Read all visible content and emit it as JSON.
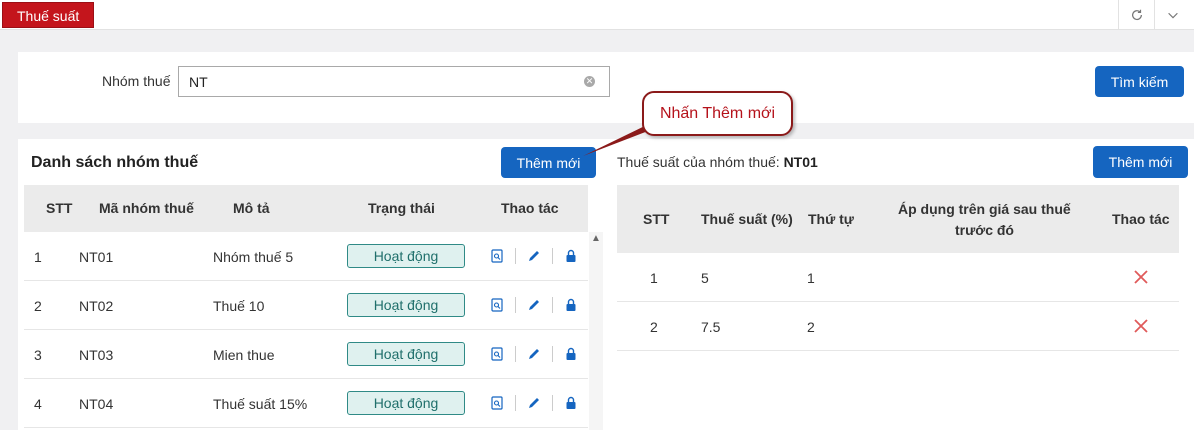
{
  "tab": {
    "label": "Thuế suất"
  },
  "search": {
    "label": "Nhóm thuế",
    "value": "NT",
    "button": "Tìm kiếm"
  },
  "left": {
    "title": "Danh sách nhóm thuế",
    "add_button": "Thêm mới",
    "columns": [
      "STT",
      "Mã nhóm thuế",
      "Mô tả",
      "Trạng thái",
      "Thao tác"
    ],
    "rows": [
      {
        "stt": "1",
        "code": "NT01",
        "desc": "Nhóm thuế 5",
        "status": "Hoạt động"
      },
      {
        "stt": "2",
        "code": "NT02",
        "desc": "Thuế 10",
        "status": "Hoạt động"
      },
      {
        "stt": "3",
        "code": "NT03",
        "desc": "Mien thue",
        "status": "Hoạt động"
      },
      {
        "stt": "4",
        "code": "NT04",
        "desc": "Thuế suất 15%",
        "status": "Hoạt động"
      }
    ]
  },
  "right": {
    "title_prefix": "Thuế suất của nhóm thuế:",
    "title_group": "NT01",
    "add_button": "Thêm mới",
    "columns": [
      "STT",
      "Thuế suất (%)",
      "Thứ tự",
      "Áp dụng trên giá sau thuế",
      "trước đó",
      "Thao tác"
    ],
    "rows": [
      {
        "stt": "1",
        "rate": "5",
        "order": "1"
      },
      {
        "stt": "2",
        "rate": "7.5",
        "order": "2"
      }
    ]
  },
  "callout": {
    "text": "Nhấn Thêm mới"
  },
  "colors": {
    "brand_red": "#c4151c",
    "primary_blue": "#1565c0",
    "status_teal": "#2f8a86",
    "delete_red": "#e05a5a"
  }
}
